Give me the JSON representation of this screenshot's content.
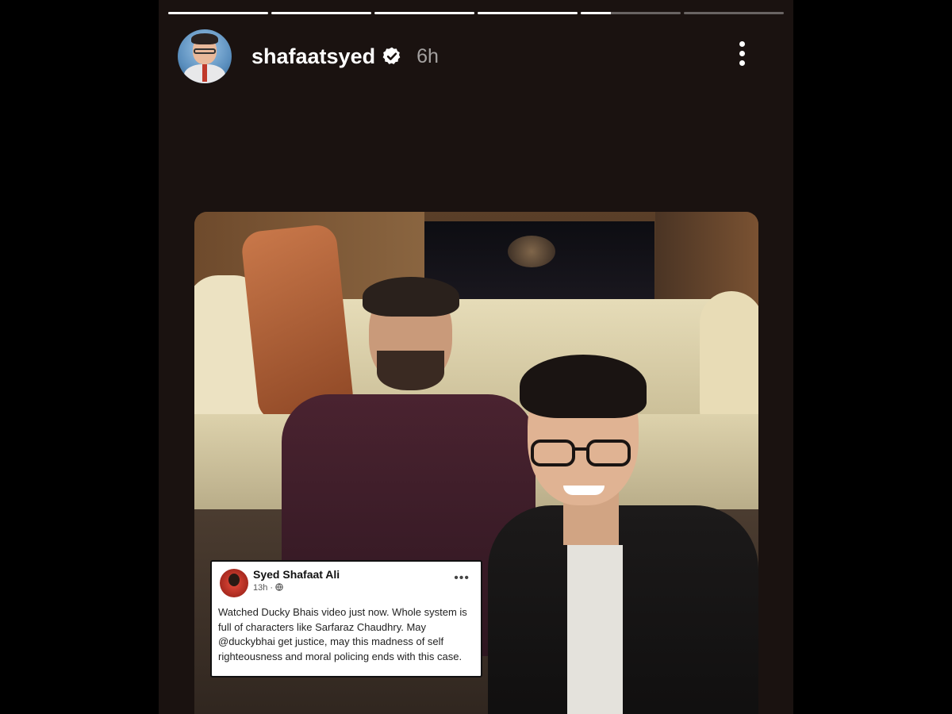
{
  "progress": [
    1,
    1,
    1,
    1,
    0.3,
    0
  ],
  "story": {
    "username": "shafaatsyed",
    "verified": true,
    "time": "6h"
  },
  "post": {
    "author": "Syed Shafaat Ali",
    "time": "13h",
    "text": "Watched Ducky Bhais video just now. Whole system is full of characters like Sarfaraz Chaudhry. May @duckybhai get justice, may this madness of self righteousness and moral policing ends with this case.",
    "more_label": "•••"
  },
  "icons": {
    "verified": "verified-badge-icon",
    "more": "more-options-icon",
    "globe": "globe-icon"
  }
}
